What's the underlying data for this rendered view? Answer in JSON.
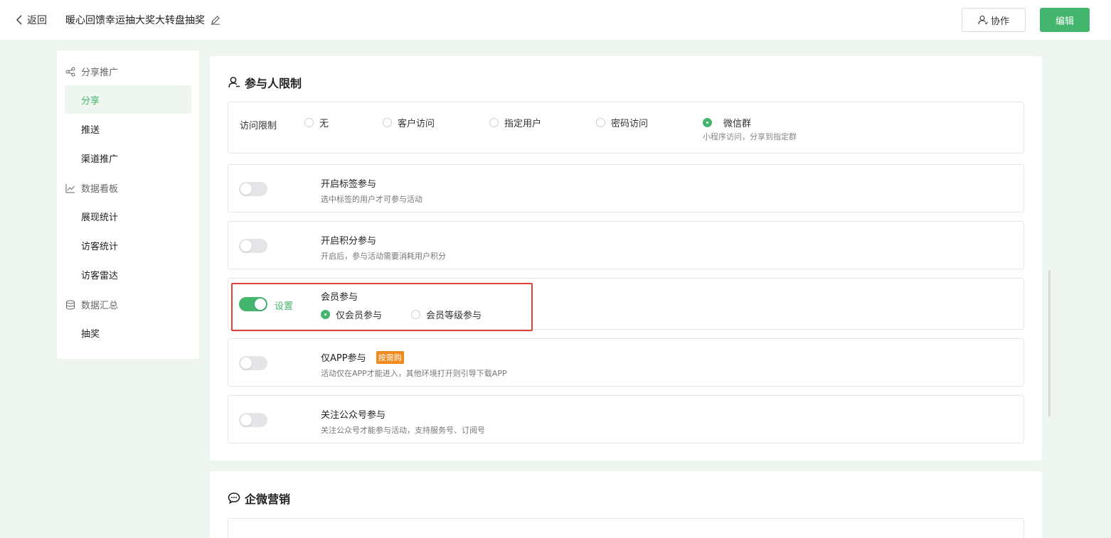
{
  "header": {
    "back_label": "返回",
    "title": "暖心回馈幸运抽大奖大转盘抽奖",
    "collab_label": "协作",
    "edit_label": "编辑"
  },
  "sidebar": {
    "groups": [
      {
        "label": "分享推广",
        "icon": "share-icon",
        "items": [
          "分享",
          "推送",
          "渠道推广"
        ]
      },
      {
        "label": "数据看板",
        "icon": "line-chart-icon",
        "items": [
          "展现统计",
          "访客统计",
          "访客雷达"
        ]
      },
      {
        "label": "数据汇总",
        "icon": "database-icon",
        "items": [
          "抽奖"
        ]
      }
    ],
    "active_item": "分享"
  },
  "participant": {
    "title": "参与人限制",
    "access": {
      "label": "访问限制",
      "options": [
        "无",
        "客户访问",
        "指定用户",
        "密码访问",
        "微信群"
      ],
      "selected": "微信群",
      "selected_sub": "小程序访问，分享到指定群"
    },
    "rows": [
      {
        "title": "开启标签参与",
        "desc": "选中标签的用户才可参与活动",
        "on": false
      },
      {
        "title": "开启积分参与",
        "desc": "开启后，参与活动需要消耗用户积分",
        "on": false
      },
      {
        "title": "会员参与",
        "on": true,
        "set_label": "设置",
        "options": [
          "仅会员参与",
          "会员等级参与"
        ],
        "selected": "仅会员参与"
      },
      {
        "title": "仅APP参与",
        "badge": "按需购",
        "desc": "活动仅在APP才能进入，其他环境打开则引导下载APP",
        "on": false
      },
      {
        "title": "关注公众号参与",
        "desc": "关注公众号才能参与活动，支持服务号、订阅号",
        "on": false
      }
    ]
  },
  "wecom": {
    "title": "企微营销"
  },
  "colors": {
    "accent": "#44b56d",
    "highlight": "#e0403a",
    "badge": "#f08a1d"
  }
}
